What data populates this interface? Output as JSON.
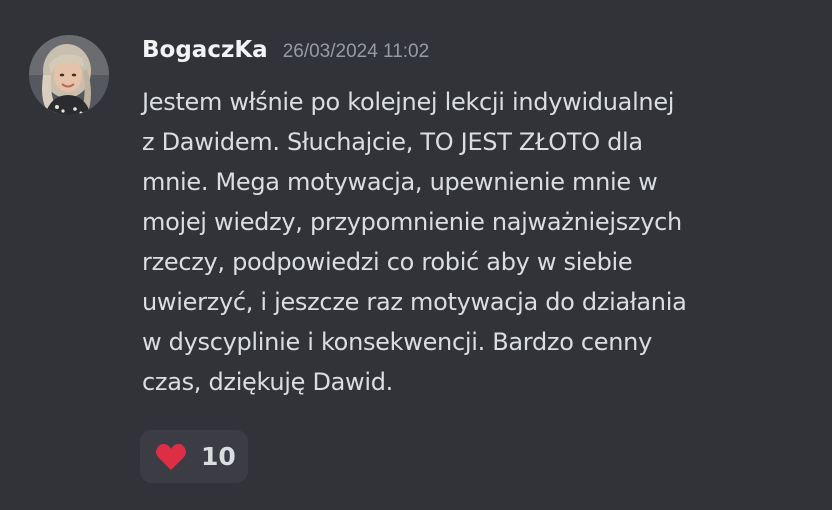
{
  "message": {
    "author": "BogaczKa",
    "timestamp": "26/03/2024 11:02",
    "lines": [
      "Jestem włśnie po kolejnej lekcji indywidualnej",
      "z Dawidem. Słuchajcie, TO JEST ZŁOTO dla",
      "mnie. Mega motywacja, upewnienie mnie w",
      "mojej wiedzy, przypomnienie najważniejszych",
      "rzeczy, podpowiedzi co robić aby w siebie",
      "uwierzyć, i jeszcze raz motywacja do działania",
      "w dyscyplinie i konsekwencji. Bardzo cenny",
      "czas, dziękuję Dawid."
    ],
    "reaction": {
      "emoji": "heart-icon",
      "count": "10",
      "color": "#dd2e44"
    }
  },
  "colors": {
    "background": "#323339",
    "username": "#f2f3f5",
    "timestamp": "#949ba4",
    "text": "#dbdee1",
    "reaction_bg": "#3c3d44"
  }
}
